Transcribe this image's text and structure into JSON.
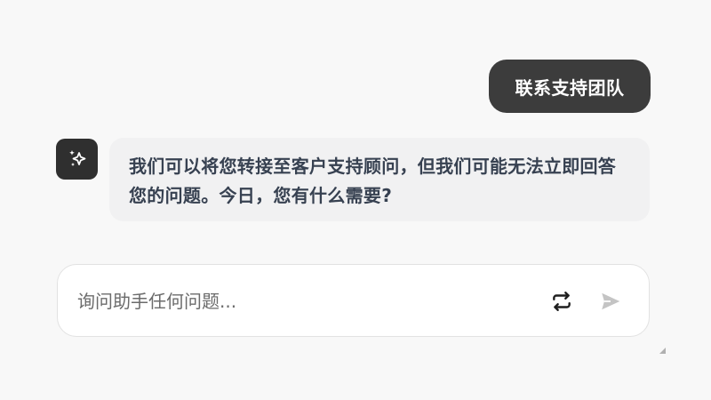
{
  "chat": {
    "user_message": "联系支持团队",
    "assistant_message": "我们可以将您转接至客户支持顾问，但我们可能无法立即回答您的问题。今日，您有什么需要?"
  },
  "composer": {
    "placeholder": "询问助手任何问题...",
    "value": ""
  },
  "icons": {
    "avatar": "sparkle-icon",
    "refresh": "repeat-arrows-icon",
    "send": "send-arrow-icon"
  },
  "colors": {
    "page_bg": "#f8f8f8",
    "user_bubble": "#3c3c3c",
    "assistant_bubble": "#f1f1f2",
    "assistant_text": "#374151",
    "send_icon_disabled": "#c4c4c4"
  }
}
